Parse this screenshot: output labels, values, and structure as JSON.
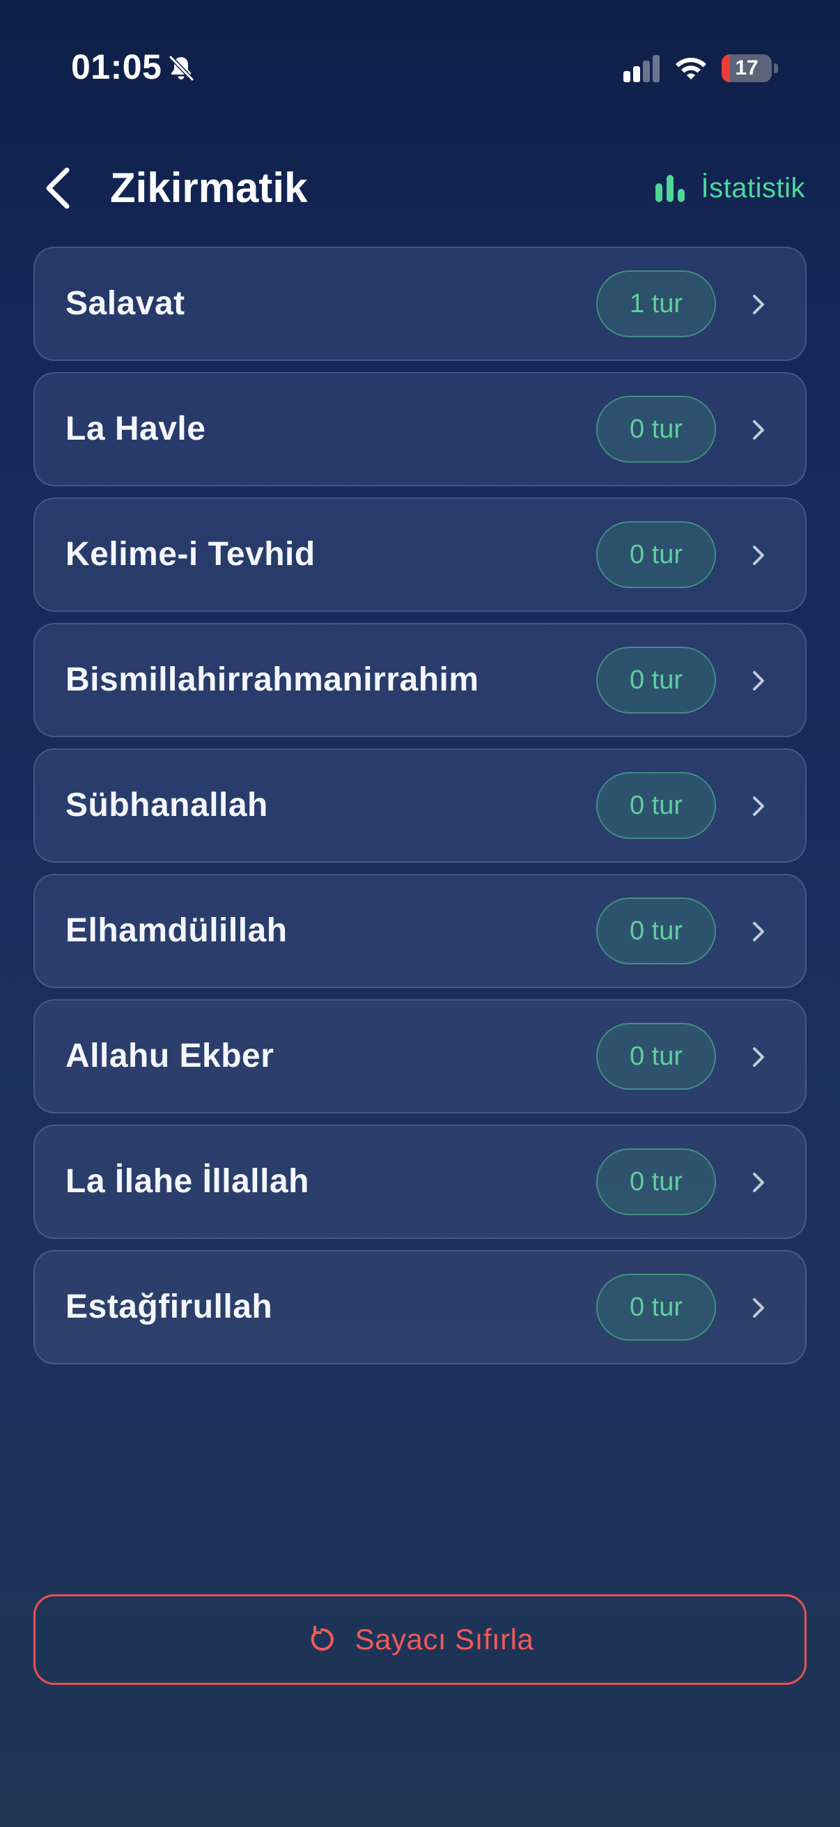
{
  "status_bar": {
    "time": "01:05",
    "battery_percent": "17",
    "battery_level": 0.17
  },
  "header": {
    "title": "Zikirmatik",
    "stats_label": "İstatistik"
  },
  "zikr_items": [
    {
      "name": "Salavat",
      "count": "1 tur"
    },
    {
      "name": "La Havle",
      "count": "0 tur"
    },
    {
      "name": "Kelime-i Tevhid",
      "count": "0 tur"
    },
    {
      "name": "Bismillahirrahmanirrahim",
      "count": "0 tur"
    },
    {
      "name": "Sübhanallah",
      "count": "0 tur"
    },
    {
      "name": "Elhamdülillah",
      "count": "0 tur"
    },
    {
      "name": "Allahu Ekber",
      "count": "0 tur"
    },
    {
      "name": "La İlahe İllallah",
      "count": "0 tur"
    },
    {
      "name": "Estağfirullah",
      "count": "0 tur"
    }
  ],
  "reset_button": {
    "label": "Sayacı Sıfırla"
  },
  "colors": {
    "accent_green": "#4fd79a",
    "danger_red": "#e85050",
    "battery_low": "#ec3b3b"
  },
  "icons": {
    "back": "chevron-left-icon",
    "stats": "bar-chart-icon",
    "row": "chevron-right-icon",
    "reset": "rotate-ccw-icon",
    "silent": "bell-off-icon",
    "signal": "cellular-signal-icon",
    "wifi": "wifi-icon"
  }
}
